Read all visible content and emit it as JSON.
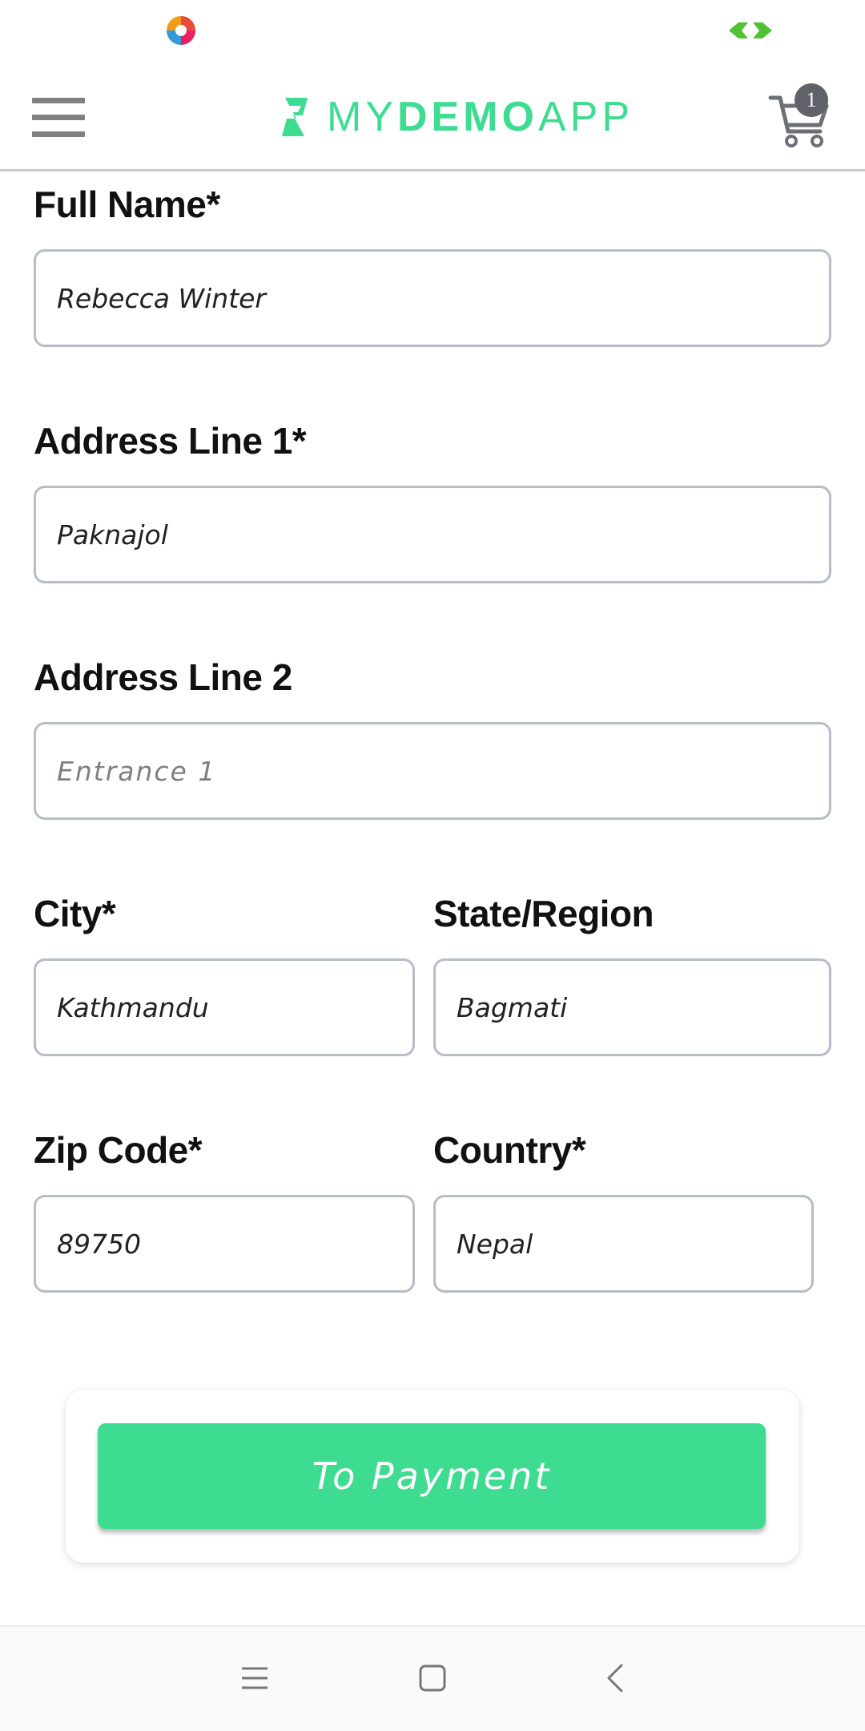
{
  "header": {
    "logo_light_1": "MY",
    "logo_bold": "DEMO",
    "logo_light_2": "APP",
    "cart_count": "1"
  },
  "form": {
    "full_name": {
      "label": "Full Name*",
      "value": "Rebecca Winter"
    },
    "address1": {
      "label": "Address Line 1*",
      "value": "Paknajol"
    },
    "address2": {
      "label": "Address Line 2",
      "placeholder": "Entrance 1"
    },
    "city": {
      "label": "City*",
      "value": "Kathmandu"
    },
    "state": {
      "label": "State/Region",
      "value": "Bagmati"
    },
    "zip": {
      "label": "Zip Code*",
      "value": "89750"
    },
    "country": {
      "label": "Country*",
      "value": "Nepal"
    }
  },
  "payment": {
    "button_label": "To Payment"
  },
  "colors": {
    "accent": "#3ddc91",
    "input_border": "#b7bcc8",
    "badge": "#5f6268"
  },
  "icons": [
    "app-status-icon",
    "battery-icon",
    "menu-icon",
    "logo-icon",
    "cart-icon",
    "nav-menu-icon",
    "nav-home-icon",
    "nav-back-icon"
  ]
}
